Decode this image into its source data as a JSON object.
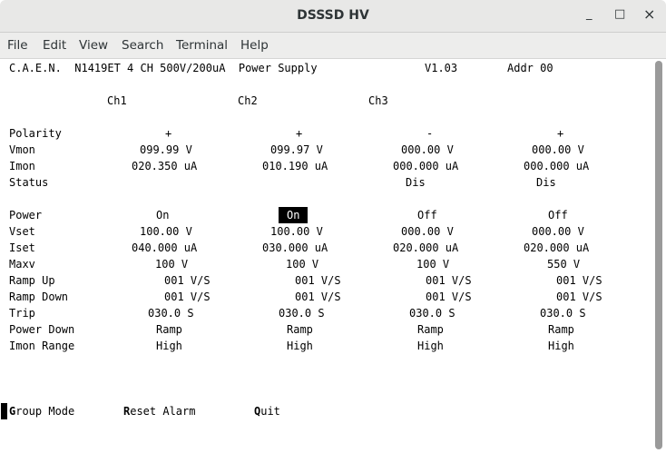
{
  "window": {
    "title": "DSSSD HV",
    "minimize": "_",
    "maximize": "□",
    "close": "×"
  },
  "menu": [
    "File",
    "Edit",
    "View",
    "Search",
    "Terminal",
    "Help"
  ],
  "header": {
    "model": "C.A.E.N.  N1419ET 4 CH 500V/200uA  Power Supply",
    "version": "V1.03",
    "addr": "Addr 00"
  },
  "channels": [
    "Ch1",
    "Ch2",
    "Ch3"
  ],
  "rows": [
    {
      "label": "Polarity",
      "values": [
        "+",
        "+",
        "-",
        "+"
      ]
    },
    {
      "label": "Vmon",
      "values": [
        "099.99 V",
        "099.97 V",
        "000.00 V",
        "000.00 V"
      ]
    },
    {
      "label": "Imon",
      "values": [
        "020.350 uA",
        "010.190 uA",
        "000.000 uA",
        "000.000 uA"
      ]
    },
    {
      "label": "Status",
      "values": [
        "",
        "",
        "Dis",
        "Dis"
      ]
    },
    {
      "label": "Power",
      "values": [
        "On",
        "On",
        "Off",
        "Off"
      ]
    },
    {
      "label": "Vset",
      "values": [
        "100.00 V",
        "100.00 V",
        "000.00 V",
        "000.00 V"
      ]
    },
    {
      "label": "Iset",
      "values": [
        "040.000 uA",
        "030.000 uA",
        "020.000 uA",
        "020.000 uA"
      ]
    },
    {
      "label": "Maxv",
      "values": [
        "100 V",
        "100 V",
        "100 V",
        "550 V"
      ]
    },
    {
      "label": "Ramp Up",
      "values": [
        "001 V/S",
        "001 V/S",
        "001 V/S",
        "001 V/S"
      ]
    },
    {
      "label": "Ramp Down",
      "values": [
        "001 V/S",
        "001 V/S",
        "001 V/S",
        "001 V/S"
      ]
    },
    {
      "label": "Trip",
      "values": [
        "030.0 S",
        "030.0 S",
        "030.0 S",
        "030.0 S"
      ]
    },
    {
      "label": "Power Down",
      "values": [
        "Ramp",
        "Ramp",
        "Ramp",
        "Ramp"
      ]
    },
    {
      "label": "Imon Range",
      "values": [
        "High",
        "High",
        "High",
        "High"
      ]
    }
  ],
  "selected_cell": {
    "row": "Power",
    "channel": 2
  },
  "actions": [
    {
      "key": "G",
      "rest": "roup Mode"
    },
    {
      "key": "R",
      "rest": "eset Alarm"
    },
    {
      "key": "Q",
      "rest": "uit"
    }
  ]
}
